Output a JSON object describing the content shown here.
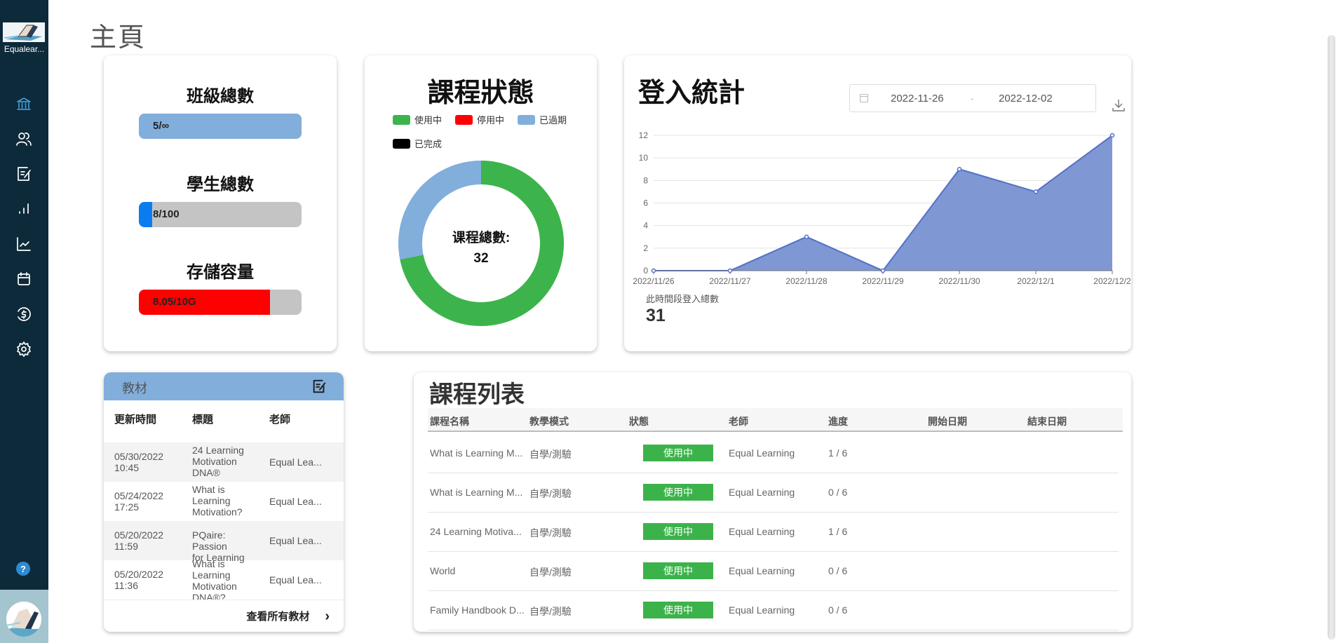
{
  "app": {
    "name": "Equalear..."
  },
  "sidebar": {
    "items": [
      {
        "name": "home",
        "icon": "bank-icon",
        "active": true
      },
      {
        "name": "users",
        "icon": "users-icon",
        "active": false
      },
      {
        "name": "assignments",
        "icon": "edit-note-icon",
        "active": false
      },
      {
        "name": "statistics",
        "icon": "bar-chart-icon",
        "active": false
      },
      {
        "name": "analytics",
        "icon": "line-chart-icon",
        "active": false
      },
      {
        "name": "calendar",
        "icon": "calendar-icon",
        "active": false
      },
      {
        "name": "billing",
        "icon": "dollar-circle-icon",
        "active": false
      },
      {
        "name": "settings",
        "icon": "gear-icon",
        "active": false
      }
    ],
    "help_label": "?"
  },
  "page": {
    "title": "主頁"
  },
  "stats": {
    "classes": {
      "label": "班級總數",
      "value_text": "5/∞",
      "fraction": 1.0,
      "color": "#82aedc"
    },
    "students": {
      "label": "學生總數",
      "value_text": "8/100",
      "fraction": 0.08,
      "color": "#0a7cf0"
    },
    "storage": {
      "label": "存儲容量",
      "value_text": "8.05/10G",
      "fraction": 0.805,
      "color": "#ff0000"
    }
  },
  "course_status": {
    "title": "課程狀態",
    "center_label": "课程總數:",
    "center_value": "32"
  },
  "login_stats": {
    "title": "登入統計",
    "date_start": "2022-11-26",
    "date_sep": "-",
    "date_end": "2022-12-02",
    "total_label": "此時間段登入總數",
    "total_value": "31"
  },
  "materials": {
    "title": "教材",
    "headers": [
      "更新時間",
      "標題",
      "老師"
    ],
    "rows": [
      {
        "date": "05/30/2022",
        "time": "10:45",
        "title_lines": [
          "24 Learning",
          "Motivation",
          "DNA®"
        ],
        "teacher": "Equal Lea..."
      },
      {
        "date": "05/24/2022",
        "time": "17:25",
        "title_lines": [
          "What is",
          "Learning",
          "Motivation?"
        ],
        "teacher": "Equal Lea..."
      },
      {
        "date": "05/20/2022",
        "time": "11:59",
        "title_lines": [
          "PQaire: Passion",
          "for Learning"
        ],
        "teacher": "Equal Lea..."
      },
      {
        "date": "05/20/2022",
        "time": "11:36",
        "title_lines": [
          "What is",
          "Learning",
          "Motivation",
          "DNA®?"
        ],
        "teacher": "Equal Lea..."
      }
    ],
    "view_all": "查看所有教材"
  },
  "course_list": {
    "title": "課程列表",
    "headers": [
      "課程名稱",
      "教學模式",
      "狀態",
      "老師",
      "進度",
      "開始日期",
      "結束日期"
    ],
    "rows": [
      {
        "name": "What is Learning M...",
        "mode": "自學/測驗",
        "status": "使用中",
        "teacher": "Equal Learning",
        "progress": "1 / 6",
        "start": "",
        "end": ""
      },
      {
        "name": "What is Learning M...",
        "mode": "自學/測驗",
        "status": "使用中",
        "teacher": "Equal Learning",
        "progress": "0 / 6",
        "start": "",
        "end": ""
      },
      {
        "name": "24 Learning Motiva...",
        "mode": "自學/測驗",
        "status": "使用中",
        "teacher": "Equal Learning",
        "progress": "1 / 6",
        "start": "",
        "end": ""
      },
      {
        "name": "World",
        "mode": "自學/測驗",
        "status": "使用中",
        "teacher": "Equal Learning",
        "progress": "0 / 6",
        "start": "",
        "end": ""
      },
      {
        "name": "Family Handbook D...",
        "mode": "自學/測驗",
        "status": "使用中",
        "teacher": "Equal Learning",
        "progress": "0 / 6",
        "start": "",
        "end": ""
      }
    ]
  },
  "chart_data": [
    {
      "type": "pie",
      "title": "課程狀態",
      "donut": true,
      "legend_position": "top",
      "categories": [
        "使用中",
        "停用中",
        "已過期",
        "已完成"
      ],
      "colors": [
        "#3cb44b",
        "#ff0000",
        "#82aedc",
        "#000000"
      ],
      "values": [
        23,
        0,
        9,
        0
      ],
      "total": 32
    },
    {
      "type": "area",
      "title": "登入統計",
      "xlabel": "",
      "ylabel": "",
      "categories": [
        "2022/11/26",
        "2022/11/27",
        "2022/11/28",
        "2022/11/29",
        "2022/11/30",
        "2022/12/1",
        "2022/12/2"
      ],
      "values": [
        0,
        0,
        3,
        0,
        9,
        7,
        12
      ],
      "ylim": [
        0,
        12
      ],
      "yticks": [
        0,
        2,
        4,
        6,
        8,
        10,
        12
      ],
      "grid": true,
      "color": "#5470c6",
      "fill_color": "#7f97d3"
    }
  ]
}
